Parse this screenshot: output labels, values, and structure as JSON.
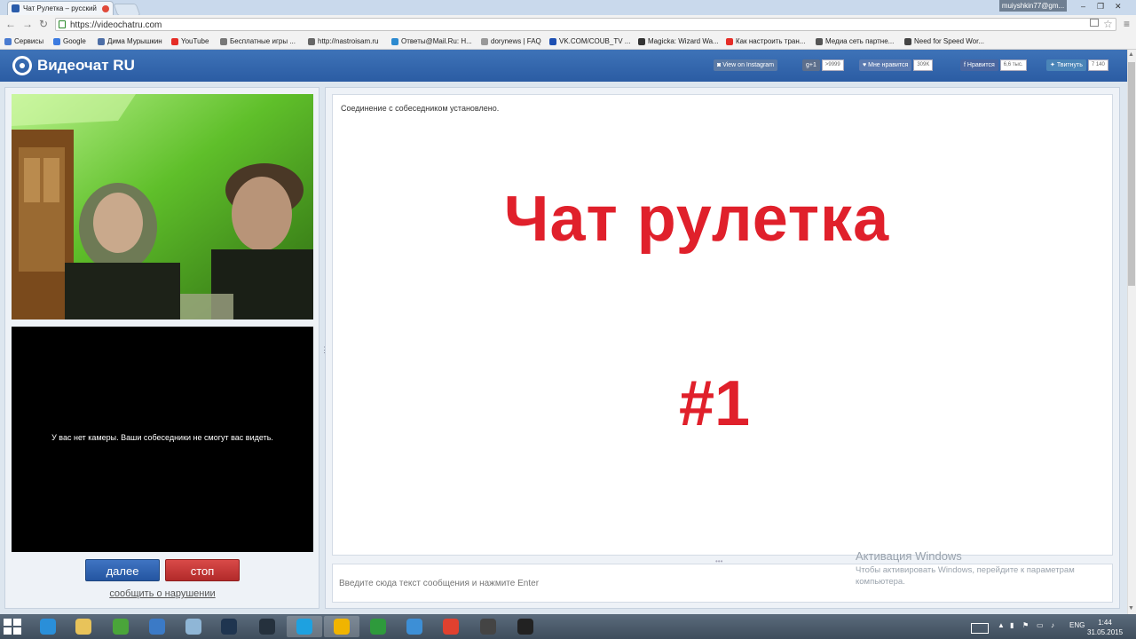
{
  "browser": {
    "tab_title": "Чат Рулетка – русский",
    "url": "https://videochatru.com",
    "user_badge": "muiyshkin77@gm...",
    "bookmarks": [
      {
        "label": "Сервисы",
        "color": "#4a7bd0"
      },
      {
        "label": "Google",
        "color": "#3c7be0"
      },
      {
        "label": "Дима Мурышкин",
        "color": "#4d6ea6"
      },
      {
        "label": "YouTube",
        "color": "#e52d27"
      },
      {
        "label": "Бесплатные игры ...",
        "color": "#777777"
      },
      {
        "label": "http://nastroisam.ru",
        "color": "#666666"
      },
      {
        "label": "Ответы@Mail.Ru: H...",
        "color": "#2c8ad0"
      },
      {
        "label": "dorynews | FAQ",
        "color": "#999999"
      },
      {
        "label": "VK.COM/COUB_TV ...",
        "color": "#1d4fb2"
      },
      {
        "label": "Magicka: Wizard Wa...",
        "color": "#333333"
      },
      {
        "label": "Как настроить тран...",
        "color": "#e52d27"
      },
      {
        "label": "Медиа сеть партне...",
        "color": "#555555"
      },
      {
        "label": "Need for Speed Wor...",
        "color": "#444444"
      }
    ]
  },
  "header": {
    "logo_text": "Видеочат RU",
    "instagram": "View on Instagram",
    "gplus": "g+1",
    "gplus_count": ">9999",
    "vk_like": "Мне нравится",
    "vk_count": "309K",
    "fb_like": "Нравится",
    "fb_count": "6,6 тыс.",
    "tweet": "Твитнуть",
    "tweet_count": "7 140"
  },
  "left": {
    "self_message": "У вас нет камеры. Ваши собеседники не смогут вас видеть.",
    "next_label": "далее",
    "stop_label": "стоп",
    "report_label": "сообщить о нарушении"
  },
  "chat": {
    "status": "Соединение с собеседником установлено.",
    "overlay_title": "Чат рулетка",
    "overlay_number": "#1",
    "input_placeholder": "Введите сюда текст сообщения и нажмите Enter"
  },
  "windows": {
    "activation_title": "Активация Windows",
    "activation_text": "Чтобы активировать Windows, перейдите к параметрам компьютера.",
    "lang": "ENG",
    "time": "1:44",
    "date": "31.05.2015"
  },
  "taskbar_apps": [
    {
      "name": "internet-explorer-icon",
      "color": "#2a8fd9"
    },
    {
      "name": "file-explorer-icon",
      "color": "#e8c35a"
    },
    {
      "name": "utorrent-icon",
      "color": "#4aa53a"
    },
    {
      "name": "crescent-app-icon",
      "color": "#3b7ac6"
    },
    {
      "name": "audio-app-icon",
      "color": "#8fb6d6"
    },
    {
      "name": "steam-icon",
      "color": "#1f3550"
    },
    {
      "name": "gear-app-icon",
      "color": "#25313d"
    },
    {
      "name": "skype-icon",
      "color": "#1ea1e0"
    },
    {
      "name": "bandicam-icon",
      "color": "#f0b400"
    },
    {
      "name": "clover-app-icon",
      "color": "#2e9a3c"
    },
    {
      "name": "media-player-icon",
      "color": "#3d8fd6"
    },
    {
      "name": "chrome-icon",
      "color": "#e0412f"
    },
    {
      "name": "world-of-tanks-icon",
      "color": "#444444"
    },
    {
      "name": "obs-icon",
      "color": "#222222"
    }
  ]
}
